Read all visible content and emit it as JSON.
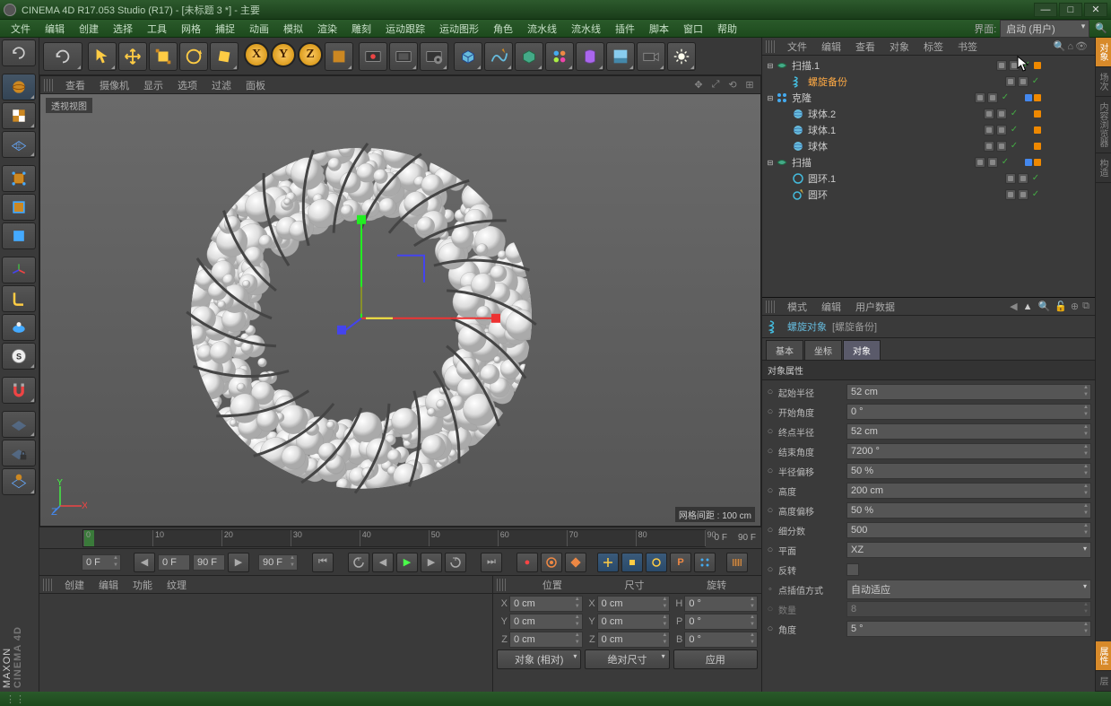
{
  "window": {
    "title": "CINEMA 4D R17.053 Studio (R17) - [未标题 3 *] - 主要"
  },
  "menus": [
    "文件",
    "编辑",
    "创建",
    "选择",
    "工具",
    "网格",
    "捕捉",
    "动画",
    "模拟",
    "渲染",
    "雕刻",
    "运动跟踪",
    "运动图形",
    "角色",
    "流水线",
    "流水线",
    "插件",
    "脚本",
    "窗口",
    "帮助"
  ],
  "layout": {
    "label": "界面:",
    "value": "启动 (用户)"
  },
  "viewport": {
    "menus": [
      "查看",
      "摄像机",
      "显示",
      "选项",
      "过滤",
      "面板"
    ],
    "label": "透视视图",
    "grid_status": "网格间距 : 100 cm"
  },
  "timeline": {
    "start": 0,
    "end": 90,
    "endlabels": [
      "0 F",
      "90 F"
    ],
    "ticks": [
      0,
      10,
      20,
      30,
      40,
      50,
      60,
      70,
      80,
      90
    ]
  },
  "playback": {
    "cur": "0 F",
    "range_a": "0 F",
    "range_b": "90 F",
    "range_c": "90 F"
  },
  "bottom_left": {
    "menus": [
      "创建",
      "编辑",
      "功能",
      "纹理"
    ]
  },
  "coords": {
    "headers": [
      "位置",
      "尺寸",
      "旋转"
    ],
    "rows": [
      {
        "axis": "X",
        "p": "0 cm",
        "s": "0 cm",
        "r_label": "H",
        "r": "0 °"
      },
      {
        "axis": "Y",
        "p": "0 cm",
        "s": "0 cm",
        "r_label": "P",
        "r": "0 °"
      },
      {
        "axis": "Z",
        "p": "0 cm",
        "s": "0 cm",
        "r_label": "B",
        "r": "0 °"
      }
    ],
    "mode": "对象 (相对)",
    "abs": "绝对尺寸",
    "apply": "应用"
  },
  "obj_panel": {
    "menus": [
      "文件",
      "编辑",
      "查看",
      "对象",
      "标签",
      "书签"
    ],
    "tree": [
      {
        "depth": 0,
        "exp": "⊟",
        "icon": "sweep",
        "name": "扫描.1",
        "hl": false,
        "tags": [
          "vis",
          "vis",
          "chk",
          "orange"
        ]
      },
      {
        "depth": 1,
        "exp": "",
        "icon": "helix",
        "name": "螺旋备份",
        "hl": true,
        "tags": [
          "vis",
          "vis",
          "chk"
        ]
      },
      {
        "depth": 0,
        "exp": "⊟",
        "icon": "cloner",
        "name": "克隆",
        "hl": false,
        "tags": [
          "vis",
          "vis",
          "chk",
          "",
          "blsm",
          "orange"
        ]
      },
      {
        "depth": 1,
        "exp": "",
        "icon": "sphere",
        "name": "球体.2",
        "hl": false,
        "tags": [
          "vis",
          "vis",
          "chk",
          "",
          "orange"
        ]
      },
      {
        "depth": 1,
        "exp": "",
        "icon": "sphere",
        "name": "球体.1",
        "hl": false,
        "tags": [
          "vis",
          "vis",
          "chk",
          "",
          "orange"
        ]
      },
      {
        "depth": 1,
        "exp": "",
        "icon": "sphere",
        "name": "球体",
        "hl": false,
        "tags": [
          "vis",
          "vis",
          "chk",
          "",
          "orange"
        ]
      },
      {
        "depth": 0,
        "exp": "⊟",
        "icon": "sweep",
        "name": "扫描",
        "hl": false,
        "tags": [
          "vis",
          "vis",
          "chk",
          "",
          "blsm",
          "orange"
        ]
      },
      {
        "depth": 1,
        "exp": "",
        "icon": "circle",
        "name": "圆环.1",
        "hl": false,
        "tags": [
          "vis",
          "vis",
          "chk"
        ]
      },
      {
        "depth": 1,
        "exp": "",
        "icon": "circle-pen",
        "name": "圆环",
        "hl": false,
        "tags": [
          "vis",
          "vis",
          "chk"
        ]
      }
    ]
  },
  "attr_panel": {
    "menus": [
      "模式",
      "编辑",
      "用户数据"
    ],
    "obj_icon": "helix",
    "obj_name": "螺旋对象",
    "obj_extra": "[螺旋备份]",
    "tabs": [
      "基本",
      "坐标",
      "对象"
    ],
    "active_tab": 2,
    "section": "对象属性",
    "props": [
      {
        "label": "起始半径",
        "value": "52 cm",
        "type": "num"
      },
      {
        "label": "开始角度",
        "value": "0 °",
        "type": "num"
      },
      {
        "label": "终点半径",
        "value": "52 cm",
        "type": "num"
      },
      {
        "label": "结束角度",
        "value": "7200 °",
        "type": "num"
      },
      {
        "label": "半径偏移",
        "value": "50 %",
        "type": "num"
      },
      {
        "label": "高度",
        "value": "200 cm",
        "type": "num"
      },
      {
        "label": "高度偏移",
        "value": "50 %",
        "type": "num"
      },
      {
        "label": "细分数",
        "value": "500",
        "type": "num"
      },
      {
        "label": "平面",
        "value": "XZ",
        "type": "dd"
      },
      {
        "label": "反转",
        "value": "",
        "type": "chk"
      },
      {
        "label": "点插值方式",
        "value": "自动适应",
        "type": "dd",
        "bullet": true
      },
      {
        "label": "数量",
        "value": "8",
        "type": "num",
        "disabled": true
      },
      {
        "label": "角度",
        "value": "5 °",
        "type": "num"
      }
    ]
  },
  "right_tabs_top": [
    "对象",
    "场次",
    "内容浏览器",
    "构造"
  ],
  "right_tabs_bot": [
    "属性",
    "层"
  ]
}
